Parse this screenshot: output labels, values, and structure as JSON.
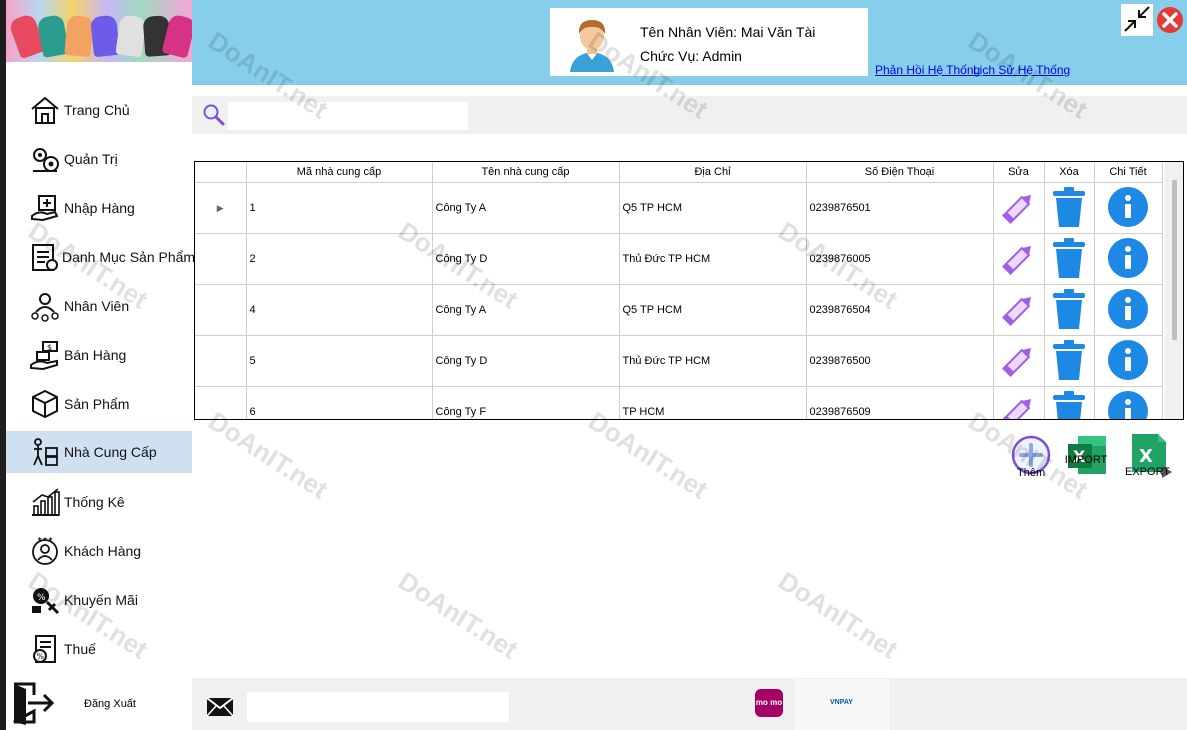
{
  "user": {
    "name": "Tên Nhân Viên: Mai Văn Tài",
    "role": "Chức Vụ: Admin"
  },
  "top_links": {
    "feedback": "Phản Hồi Hệ Thống",
    "history": "Lịch Sử Hệ Thống"
  },
  "sidebar": {
    "items": [
      {
        "label": "Trang Chủ",
        "icon": "home-icon"
      },
      {
        "label": "Quản Trị",
        "icon": "admin-gears-icon"
      },
      {
        "label": "Nhập Hàng",
        "icon": "import-goods-icon"
      },
      {
        "label": "Danh Mục Sản Phẩm",
        "icon": "category-icon"
      },
      {
        "label": "Nhân Viên",
        "icon": "employee-icon"
      },
      {
        "label": "Bán Hàng",
        "icon": "sales-icon"
      },
      {
        "label": "Sản Phẩm",
        "icon": "product-box-icon"
      },
      {
        "label": "Nhà Cung Cấp",
        "icon": "supplier-icon"
      },
      {
        "label": "Thống Kê",
        "icon": "statistics-chart-icon"
      },
      {
        "label": "Khách Hàng",
        "icon": "customer-icon"
      },
      {
        "label": "Khuyến Mãi",
        "icon": "promotion-icon"
      },
      {
        "label": "Thuế",
        "icon": "tax-icon"
      }
    ],
    "active_index": 7,
    "logout_label": "Đăng Xuất"
  },
  "table": {
    "columns": [
      "Mã nhà cung cấp",
      "Tên nhà cung cấp",
      "Địa Chỉ",
      "Số Điện Thoại",
      "Sửa",
      "Xóa",
      "Chi Tiết"
    ],
    "rows": [
      {
        "id": "1",
        "name": "Công Ty A",
        "address": "Q5 TP HCM",
        "phone": "0239876501"
      },
      {
        "id": "2",
        "name": "Công Ty D",
        "address": "Thủ Đức TP HCM",
        "phone": "0239876005"
      },
      {
        "id": "4",
        "name": "Công Ty A",
        "address": "Q5 TP HCM",
        "phone": "0239876504"
      },
      {
        "id": "5",
        "name": "Công Ty D",
        "address": "Thủ Đức TP HCM",
        "phone": "0239876500"
      },
      {
        "id": "6",
        "name": "Công Ty F",
        "address": "TP HCM",
        "phone": "0239876509"
      }
    ]
  },
  "actions": {
    "add_label": "Thêm",
    "import_label": "IMPORT",
    "export_label": "EXPORT"
  },
  "footer": {
    "momo_label": "mo mo",
    "vnpay_label": "VNPAY"
  },
  "watermark_text": "DoAnIT.net",
  "colors": {
    "topbar": "#87ceeb",
    "active_nav": "#cfe1f0",
    "edit_icon": "#a15fe8",
    "delete_icon": "#1e88e5",
    "info_icon": "#1e88e5",
    "close_button": "#e53935"
  }
}
